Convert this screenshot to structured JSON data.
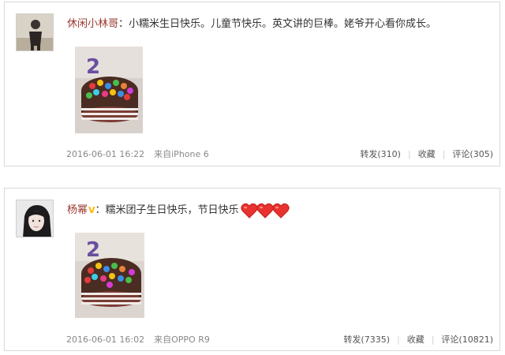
{
  "posts": [
    {
      "username": "休闲小林哥",
      "verified": "",
      "colon": "：",
      "text": "小糯米生日快乐。儿童节快乐。英文讲的巨棒。姥爷开心看你成长。",
      "hearts": 0,
      "date": "2016-06-01 16:22",
      "source": "来自iPhone 6",
      "repost_label": "转发(310)",
      "favorite_label": "收藏",
      "comment_label": "评论(305)"
    },
    {
      "username": "杨幂",
      "verified": "V",
      "colon": "：",
      "text": "糯米团子生日快乐，节日快乐",
      "hearts": 3,
      "date": "2016-06-01 16:02",
      "source": "来自OPPO R9",
      "repost_label": "转发(7335)",
      "favorite_label": "收藏",
      "comment_label": "评论(10821)"
    }
  ],
  "icons": {
    "heart": "heart-icon",
    "verified": "verified-badge-icon"
  },
  "colors": {
    "username": "#9b3a2e",
    "heart": "#e8322f",
    "verified": "#ffb400",
    "meta": "#888888"
  }
}
